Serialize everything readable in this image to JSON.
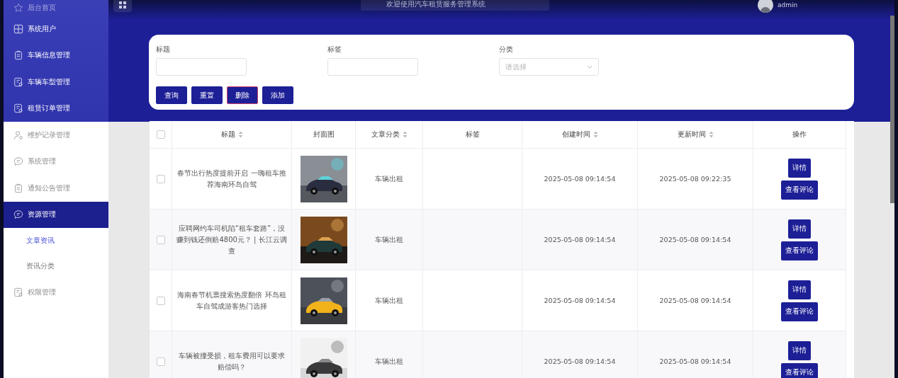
{
  "header": {
    "welcome": "欢迎使用汽车租赁服务管理系统",
    "user": "admin"
  },
  "sidebar": {
    "items": [
      {
        "label": "后台首页",
        "selected": false
      },
      {
        "label": "系统用户",
        "selected": false
      },
      {
        "label": "车辆信息管理",
        "selected": false
      },
      {
        "label": "车辆车型管理",
        "selected": false
      },
      {
        "label": "租赁订单管理",
        "selected": false
      },
      {
        "label": "维护记录管理",
        "selected": false
      },
      {
        "label": "系统管理",
        "selected": false
      },
      {
        "label": "通知公告管理",
        "selected": false
      },
      {
        "label": "资源管理",
        "selected": true,
        "children": [
          {
            "label": "文章资讯",
            "selected": true
          },
          {
            "label": "资讯分类",
            "selected": false
          }
        ]
      },
      {
        "label": "权限管理",
        "selected": false
      }
    ]
  },
  "filters": [
    {
      "kind": "input",
      "label": "标题"
    },
    {
      "kind": "input",
      "label": "标签"
    },
    {
      "kind": "select",
      "label": "分类",
      "placeholder": "请选择"
    }
  ],
  "actions": [
    {
      "label": "查询",
      "kind": "primary"
    },
    {
      "label": "重置",
      "kind": "primary"
    },
    {
      "label": "删除",
      "kind": "danger"
    },
    {
      "label": "添加",
      "kind": "primary"
    }
  ],
  "table": {
    "select_all": {
      "checked": false
    },
    "columns": [
      {
        "label": "标题",
        "sortable": true
      },
      {
        "label": "封面图",
        "sortable": false
      },
      {
        "label": "文章分类",
        "sortable": true
      },
      {
        "label": "标签",
        "sortable": false
      },
      {
        "label": "创建时间",
        "sortable": true
      },
      {
        "label": "更新时间",
        "sortable": true
      },
      {
        "label": "操作",
        "sortable": false
      }
    ],
    "rows": [
      {
        "checked": false,
        "title": "春节出行热度提前开启 一嗨租车推荐海南环岛自驾",
        "category": "车辆出租",
        "created": "2025-05-08 09:14:54",
        "updated": "2025-05-08 09:22:35",
        "buttons": [
          "详情",
          "查看评论"
        ]
      },
      {
        "checked": false,
        "title": "应聘网约车司机陷“租车套路”，没赚到钱还倒赔4800元？ | 长江云调查",
        "category": "车辆出租",
        "created": "2025-05-08 09:14:54",
        "updated": "2025-05-08 09:14:54",
        "buttons": [
          "详情",
          "查看评论"
        ]
      },
      {
        "checked": false,
        "title": "海南春节机票搜索热度翻倍 环岛租车自驾成游客热门选择",
        "category": "车辆出租",
        "created": "2025-05-08 09:14:54",
        "updated": "2025-05-08 09:14:54",
        "buttons": [
          "详情",
          "查看评论"
        ]
      },
      {
        "checked": false,
        "title": "车辆被撞受损，租车费用可以要求赔偿吗？",
        "category": "车辆出租",
        "created": "2025-05-08 09:14:54",
        "updated": "2025-05-08 09:14:54",
        "buttons": [
          "详情",
          "查看评论"
        ]
      }
    ]
  }
}
